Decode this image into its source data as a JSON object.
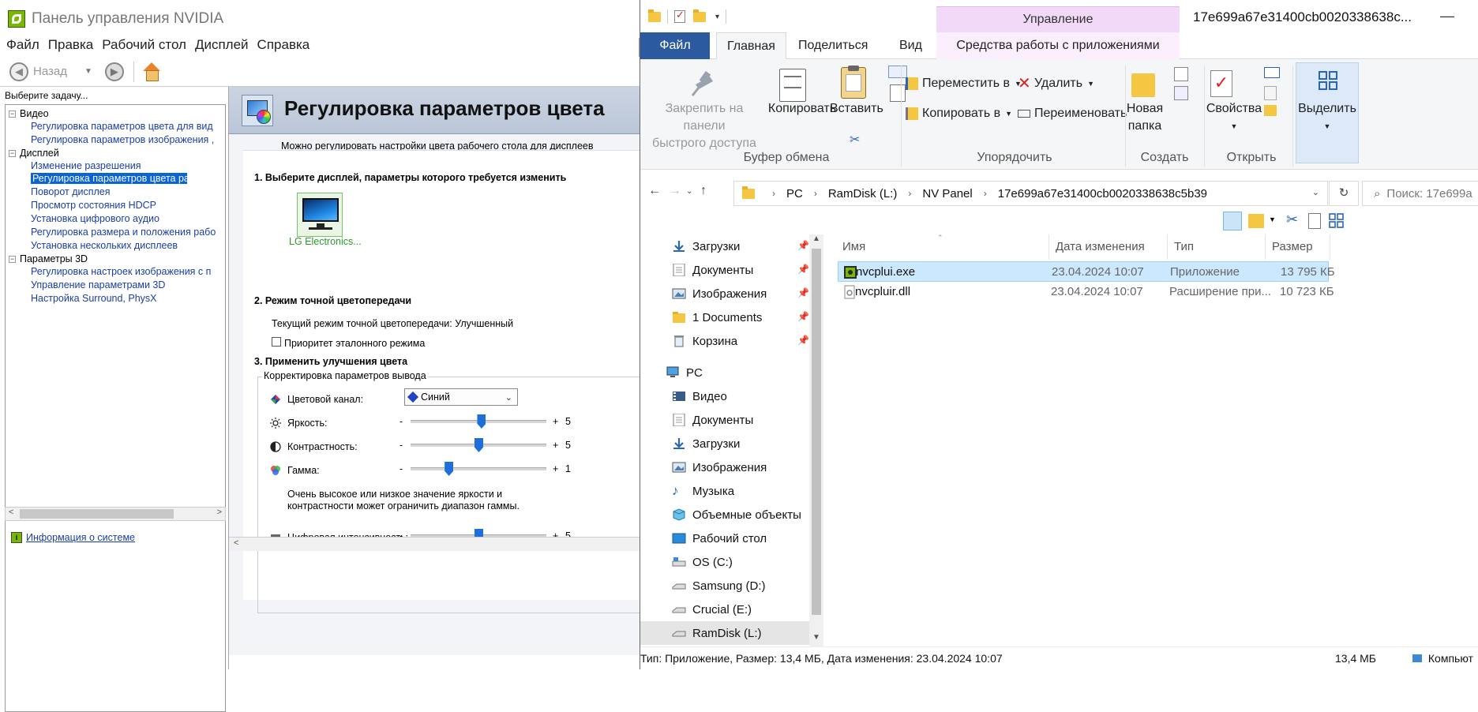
{
  "nvidia": {
    "title": "Панель управления NVIDIA",
    "menu": [
      "Файл",
      "Правка",
      "Рабочий стол",
      "Дисплей",
      "Справка"
    ],
    "back_label": "Назад",
    "task_hint": "Выберите задачу...",
    "tree": {
      "video": {
        "label": "Видео",
        "items": [
          "Регулировка параметров цвета для вид",
          "Регулировка параметров изображения ,"
        ]
      },
      "display": {
        "label": "Дисплей",
        "items": [
          "Изменение разрешения",
          "Регулировка параметров цвета рабочег",
          "Поворот дисплея",
          "Просмотр состояния HDCP",
          "Установка цифрового аудио",
          "Регулировка размера и положения рабо",
          "Установка нескольких дисплеев"
        ]
      },
      "params3d": {
        "label": "Параметры 3D",
        "items": [
          "Регулировка настроек изображения с п",
          "Управление параметрами 3D",
          "Настройка Surround, PhysX"
        ]
      }
    },
    "sysinfo_link": "Информация о системе",
    "page_title": "Регулировка параметров цвета",
    "page_desc": "Можно регулировать настройки цвета рабочего стола для дисплеев",
    "step1": "1. Выберите дисплей, параметры которого требуется изменить",
    "monitor_label": "LG Electronics...",
    "step2": "2. Режим точной цветопередачи",
    "current_mode": "Текущий режим точной цветопередачи: Улучшенный",
    "priority_label": "Приоритет эталонного режима",
    "step3": "3. Применить улучшения цвета",
    "output_group": "Корректировка параметров вывода",
    "channel_label": "Цветовой канал:",
    "channel_value": "Синий",
    "brightness_label": "Яркость:",
    "contrast_label": "Контрастность:",
    "gamma_label": "Гамма:",
    "minus": "-",
    "plus": "+",
    "brightness_val": "5",
    "contrast_val": "5",
    "gamma_val": "1",
    "warning_line1": "Очень высокое или низкое значение яркости и",
    "warning_line2": "контрастности может ограничить диапазон гаммы.",
    "digital_label": "Цифровая интенсивность:",
    "digital_val": "5",
    "sliders": {
      "brightness": 0.52,
      "contrast": 0.5,
      "gamma": 0.28,
      "digital": 0.5
    }
  },
  "explorer": {
    "manage_tab": "Управление",
    "window_title": "17e699a67e31400cb0020338638c...",
    "tabs": [
      "Файл",
      "Главная",
      "Поделиться",
      "Вид",
      "Средства работы с приложениями"
    ],
    "ribbon": {
      "pin_line1": "Закрепить на панели",
      "pin_line2": "быстрого доступа",
      "copy": "Копировать",
      "paste": "Вставить",
      "clipboard_group": "Буфер обмена",
      "move_to": "Переместить в",
      "copy_to": "Копировать в",
      "delete": "Удалить",
      "rename": "Переименовать",
      "organize_group": "Упорядочить",
      "new_folder_line1": "Новая",
      "new_folder_line2": "папка",
      "create_group": "Создать",
      "properties": "Свойства",
      "open_group": "Открыть",
      "select": "Выделить"
    },
    "address": [
      "PC",
      "RamDisk (L:)",
      "NV Panel",
      "17e699a67e31400cb0020338638c5b39"
    ],
    "search_placeholder": "Поиск: 17e699a",
    "nav": {
      "quick": [
        {
          "label": "Загрузки",
          "icon": "download-icon"
        },
        {
          "label": "Документы",
          "icon": "documents-icon"
        },
        {
          "label": "Изображения",
          "icon": "pictures-icon"
        },
        {
          "label": "1 Documents",
          "icon": "folder-icon"
        },
        {
          "label": "Корзина",
          "icon": "recycle-bin-icon"
        }
      ],
      "pc_label": "PC",
      "pc_items": [
        {
          "label": "Видео",
          "icon": "video-icon"
        },
        {
          "label": "Документы",
          "icon": "documents-icon"
        },
        {
          "label": "Загрузки",
          "icon": "download-icon"
        },
        {
          "label": "Изображения",
          "icon": "pictures-icon"
        },
        {
          "label": "Музыка",
          "icon": "music-icon"
        },
        {
          "label": "Объемные объекты",
          "icon": "3d-objects-icon"
        },
        {
          "label": "Рабочий стол",
          "icon": "desktop-icon"
        },
        {
          "label": "OS (C:)",
          "icon": "drive-icon"
        },
        {
          "label": "Samsung (D:)",
          "icon": "drive-icon"
        },
        {
          "label": "Crucial (E:)",
          "icon": "drive-icon"
        },
        {
          "label": "RamDisk (L:)",
          "icon": "drive-icon"
        }
      ]
    },
    "columns": [
      "Имя",
      "Дата изменения",
      "Тип",
      "Размер"
    ],
    "files": [
      {
        "name": "nvcplui.exe",
        "date": "23.04.2024 10:07",
        "type": "Приложение",
        "size": "13 795 КБ"
      },
      {
        "name": "nvcpluir.dll",
        "date": "23.04.2024 10:07",
        "type": "Расширение при...",
        "size": "10 723 КБ"
      }
    ],
    "status": {
      "info": "Тип: Приложение, Размер: 13,4 МБ, Дата изменения: 23.04.2024 10:07",
      "size": "13,4 МБ",
      "computer": "Компьют"
    }
  },
  "colors": {
    "nvidia_green": "#76b900",
    "selection_blue": "#0a64d7",
    "file_tab": "#2c5aa0",
    "manage_pink": "#f3d9f8"
  }
}
